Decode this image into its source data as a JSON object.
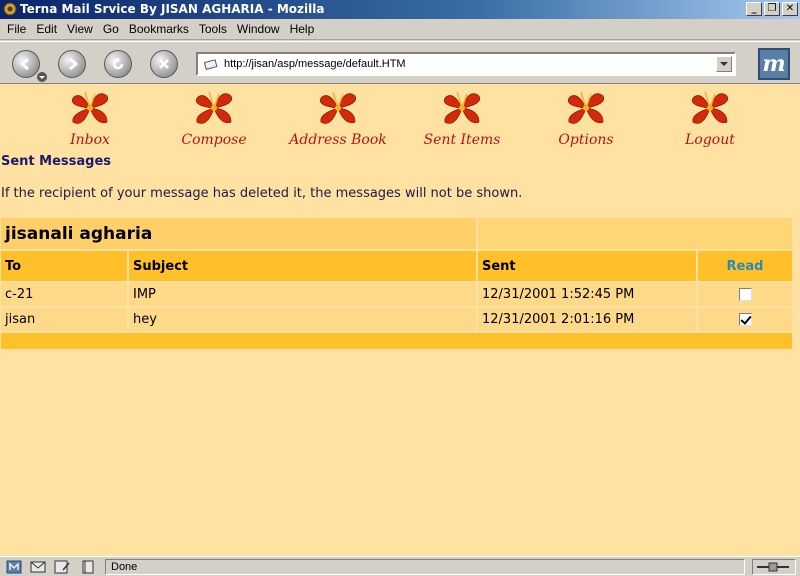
{
  "window": {
    "title": "Terna Mail Srvice By JISAN AGHARIA - Mozilla",
    "controls": [
      "_",
      "❐",
      "✕"
    ]
  },
  "menu": [
    "File",
    "Edit",
    "View",
    "Go",
    "Bookmarks",
    "Tools",
    "Window",
    "Help"
  ],
  "toolbar": {
    "address": "http://jisan/asp/message/default.HTM",
    "logo_letter": "m"
  },
  "nav": [
    {
      "label": "Inbox"
    },
    {
      "label": "Compose"
    },
    {
      "label": "Address Book"
    },
    {
      "label": "Sent Items"
    },
    {
      "label": "Options"
    },
    {
      "label": "Logout"
    }
  ],
  "page": {
    "section_title": "Sent Messages",
    "info": "If the recipient of your message has deleted it, the messages will not be shown.",
    "owner": "jisanali agharia"
  },
  "table": {
    "headers": {
      "to": "To",
      "subject": "Subject",
      "sent": "Sent",
      "read": "Read"
    },
    "rows": [
      {
        "to": "c-21",
        "subject": "IMP",
        "sent": "12/31/2001 1:52:45 PM",
        "read": false
      },
      {
        "to": "jisan",
        "subject": "hey",
        "sent": "12/31/2001 2:01:16 PM",
        "read": true
      }
    ]
  },
  "status": {
    "text": "Done"
  },
  "colors": {
    "page_bg": "#ffe1a2",
    "header_bg": "#ffc02a",
    "nav_label": "#b51414",
    "title_text": "#1a1a6e",
    "read_header": "#2b8bb5"
  }
}
